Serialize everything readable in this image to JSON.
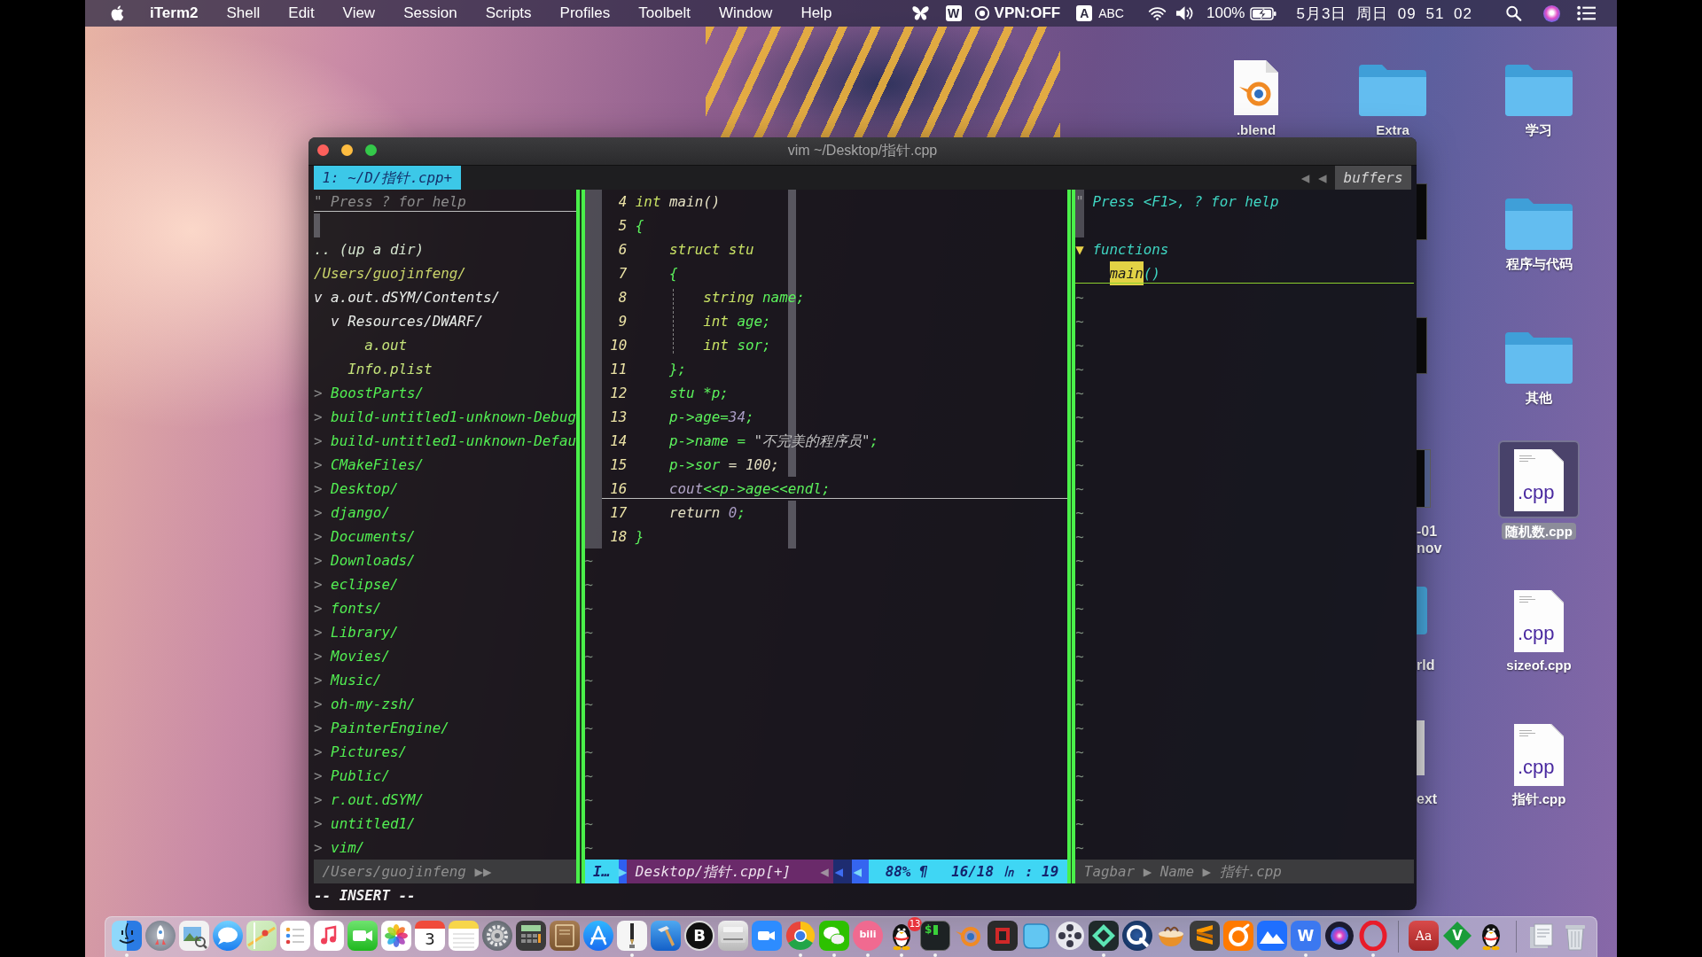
{
  "menu_bar": {
    "app_name": "iTerm2",
    "menus": [
      "Shell",
      "Edit",
      "View",
      "Session",
      "Scripts",
      "Profiles",
      "Toolbelt",
      "Window",
      "Help"
    ],
    "status_items": [
      {
        "kind": "butterfly"
      },
      {
        "kind": "letterbox",
        "text": "W"
      },
      {
        "kind": "vpn",
        "text": "VPN:OFF"
      },
      {
        "kind": "letterbox",
        "text": "A"
      },
      {
        "kind": "input",
        "text": "ABC"
      },
      {
        "kind": "wifi"
      },
      {
        "kind": "volume"
      },
      {
        "kind": "percent",
        "text": "100%"
      },
      {
        "kind": "battery"
      },
      {
        "kind": "clock",
        "text": "5月3日 周日 09 51 02"
      },
      {
        "kind": "search"
      },
      {
        "kind": "orb"
      },
      {
        "kind": "list"
      }
    ]
  },
  "desktop": {
    "icon_columns": [
      {
        "items": [
          {
            "kind": "blend",
            "label": ".blend",
            "selected": false,
            "covered": false
          }
        ]
      },
      {
        "items": [
          {
            "kind": "folder",
            "label": "Extra",
            "selected": false,
            "covered": false
          },
          {
            "kind": "thumbnail",
            "selected": false,
            "covered": true
          },
          {
            "kind": "thumbnail",
            "selected": false,
            "covered": true
          },
          {
            "kind": "screenshot",
            "label_lines": [
              "-01",
              "nov"
            ],
            "selected": false,
            "covered": true
          },
          {
            "kind": "folder",
            "label_lines": [
              "rld"
            ],
            "selected": false,
            "covered": true
          },
          {
            "kind": "document",
            "label_lines": [
              "ext"
            ],
            "selected": false,
            "covered": true
          }
        ]
      },
      {
        "items": [
          {
            "kind": "folder",
            "label": "学习",
            "selected": false,
            "covered": false
          },
          {
            "kind": "folder",
            "label": "程序与代码",
            "selected": false,
            "covered": false
          },
          {
            "kind": "folder",
            "label": "其他",
            "selected": false,
            "covered": false
          },
          {
            "kind": "document",
            "file_type": ".cpp",
            "label": "随机数.cpp",
            "selected": true,
            "covered": false
          },
          {
            "kind": "document",
            "file_type": ".cpp",
            "label": "sizeof.cpp",
            "selected": false,
            "covered": false
          },
          {
            "kind": "document",
            "file_type": ".cpp",
            "label": "指针.cpp",
            "selected": false,
            "covered": false
          }
        ]
      }
    ]
  },
  "terminal": {
    "title": "vim ~/Desktop/指针.cpp",
    "tabline": {
      "tab": "1: ~/D/指针.cpp+",
      "arrows": "◀ ◀",
      "label": "buffers"
    },
    "file_tree": {
      "help": {
        "mark": "\"",
        "text": "Press ? for help",
        "current": true
      },
      "up": ".. (up a dir)",
      "root": "/Users/guojinfeng/",
      "items": [
        {
          "kind": "dir",
          "marker": "v",
          "name": "a.out.dSYM/Contents/",
          "expanded": true,
          "children": [
            {
              "kind": "dir",
              "marker": "v",
              "name": "Resources/DWARF/",
              "expanded": true,
              "children": [
                {
                  "kind": "file",
                  "name": "a.out"
                }
              ]
            },
            {
              "kind": "file",
              "name": "Info.plist"
            }
          ]
        },
        {
          "kind": "dir",
          "marker": ">",
          "name": "BoostParts/",
          "expanded": false
        },
        {
          "kind": "dir",
          "marker": ">",
          "name": "build-untitled1-unknown-Debug",
          "expanded": false
        },
        {
          "kind": "dir",
          "marker": ">",
          "name": "build-untitled1-unknown-Defau",
          "expanded": false
        },
        {
          "kind": "dir",
          "marker": ">",
          "name": "CMakeFiles/",
          "expanded": false
        },
        {
          "kind": "dir",
          "marker": ">",
          "name": "Desktop/",
          "expanded": false
        },
        {
          "kind": "dir",
          "marker": ">",
          "name": "django/",
          "expanded": false
        },
        {
          "kind": "dir",
          "marker": ">",
          "name": "Documents/",
          "expanded": false
        },
        {
          "kind": "dir",
          "marker": ">",
          "name": "Downloads/",
          "expanded": false
        },
        {
          "kind": "dir",
          "marker": ">",
          "name": "eclipse/",
          "expanded": false
        },
        {
          "kind": "dir",
          "marker": ">",
          "name": "fonts/",
          "expanded": false
        },
        {
          "kind": "dir",
          "marker": ">",
          "name": "Library/",
          "expanded": false
        },
        {
          "kind": "dir",
          "marker": ">",
          "name": "Movies/",
          "expanded": false
        },
        {
          "kind": "dir",
          "marker": ">",
          "name": "Music/",
          "expanded": false
        },
        {
          "kind": "dir",
          "marker": ">",
          "name": "oh-my-zsh/",
          "expanded": false
        },
        {
          "kind": "dir",
          "marker": ">",
          "name": "PainterEngine/",
          "expanded": false
        },
        {
          "kind": "dir",
          "marker": ">",
          "name": "Pictures/",
          "expanded": false
        },
        {
          "kind": "dir",
          "marker": ">",
          "name": "Public/",
          "expanded": false
        },
        {
          "kind": "dir",
          "marker": ">",
          "name": "r.out.dSYM/",
          "expanded": false
        },
        {
          "kind": "dir",
          "marker": ">",
          "name": "untitled1/",
          "expanded": false
        },
        {
          "kind": "dir",
          "marker": ">",
          "name": "vim/",
          "expanded": false
        }
      ]
    },
    "editor": {
      "cursor_column": true,
      "lines": [
        {
          "number": "4",
          "current": false,
          "tokens": [
            {
              "kind": "type",
              "text": "int"
            },
            {
              "kind": "plain",
              "text": " main()"
            }
          ]
        },
        {
          "number": "5",
          "current": false,
          "tokens": [
            {
              "kind": "ident",
              "text": "{"
            }
          ],
          "children": [
            {
              "number": "6",
              "current": false,
              "tokens": [
                {
                  "kind": "type",
                  "text": "struct stu"
                }
              ]
            },
            {
              "number": "7",
              "current": false,
              "tokens": [
                {
                  "kind": "ident",
                  "text": "{"
                }
              ],
              "children": [
                {
                  "number": "8",
                  "current": false,
                  "tokens": [
                    {
                      "kind": "type",
                      "text": "string"
                    },
                    {
                      "kind": "ident",
                      "text": " name;"
                    }
                  ]
                },
                {
                  "number": "9",
                  "current": false,
                  "tokens": [
                    {
                      "kind": "type",
                      "text": "int"
                    },
                    {
                      "kind": "ident",
                      "text": " age;"
                    }
                  ]
                },
                {
                  "number": "10",
                  "current": false,
                  "tokens": [
                    {
                      "kind": "type",
                      "text": "int"
                    },
                    {
                      "kind": "ident",
                      "text": " sor;"
                    }
                  ]
                }
              ]
            },
            {
              "number": "11",
              "current": false,
              "tokens": [
                {
                  "kind": "ident",
                  "text": "};"
                }
              ]
            },
            {
              "number": "12",
              "current": false,
              "tokens": [
                {
                  "kind": "ident",
                  "text": "stu *p;"
                }
              ]
            },
            {
              "number": "13",
              "current": false,
              "tokens": [
                {
                  "kind": "ident",
                  "text": "p->age="
                },
                {
                  "kind": "number",
                  "text": "34"
                },
                {
                  "kind": "ident",
                  "text": ";"
                }
              ]
            },
            {
              "number": "14",
              "current": false,
              "tokens": [
                {
                  "kind": "ident",
                  "text": "p->name = "
                },
                {
                  "kind": "string",
                  "text": "\"不完美的程序员\""
                },
                {
                  "kind": "ident",
                  "text": ";"
                }
              ]
            },
            {
              "number": "15",
              "current": false,
              "tokens": [
                {
                  "kind": "ident",
                  "text": "p->sor"
                },
                {
                  "kind": "plain",
                  "text": " = 100;"
                }
              ]
            },
            {
              "number": "16",
              "current": true,
              "tokens": [
                {
                  "kind": "builtin",
                  "text": "cout"
                },
                {
                  "kind": "ident",
                  "text": "<<p->age<<endl;"
                }
              ]
            },
            {
              "number": "17",
              "current": false,
              "tokens": [
                {
                  "kind": "plain",
                  "text": "return "
                },
                {
                  "kind": "number",
                  "text": "0"
                },
                {
                  "kind": "ident",
                  "text": ";"
                }
              ]
            }
          ]
        },
        {
          "number": "18",
          "current": false,
          "tokens": [
            {
              "kind": "ident",
              "text": "}"
            }
          ]
        }
      ],
      "empty_lines": [
        "~",
        "~",
        "~",
        "~",
        "~",
        "~",
        "~",
        "~",
        "~",
        "~",
        "~",
        "~",
        "~"
      ]
    },
    "tagbar": {
      "help": {
        "mark": "\"",
        "text": "Press <F1>, ? for help"
      },
      "groups": [
        {
          "marker": "▼",
          "label": "functions",
          "expanded": true,
          "tags": [
            {
              "name": "main",
              "signature": "()",
              "highlighted": true,
              "current": true
            }
          ]
        }
      ],
      "empty_lines": [
        "~",
        "~",
        "~",
        "~",
        "~",
        "~",
        "~",
        "~",
        "~",
        "~",
        "~",
        "~",
        "~",
        "~",
        "~",
        "~",
        "~",
        "~",
        "~",
        "~",
        "~",
        "~",
        "~",
        "~"
      ]
    },
    "status_line": {
      "tree_path": "/Users/guojinfeng",
      "tree_arrows": "▶▶",
      "segments": [
        {
          "kind": "mode",
          "text": "I…"
        },
        {
          "kind": "arrow-in",
          "text": "▶"
        },
        {
          "kind": "file",
          "text": "Desktop/指针.cpp[+]"
        },
        {
          "kind": "arrow-soft",
          "text": "◀"
        },
        {
          "kind": "arrow-dark",
          "text": "◀"
        },
        {
          "kind": "arrow-light",
          "text": "◀"
        },
        {
          "kind": "info",
          "text": "88% ¶"
        },
        {
          "kind": "info",
          "text": "16/18 ㏑ : 19"
        }
      ],
      "tagbar": "Tagbar ▶ Name ▶ 指针.cpp"
    },
    "command_line": "-- INSERT --"
  },
  "dock": {
    "groups": [
      {
        "apps": [
          {
            "kind": "face",
            "running": true
          },
          {
            "kind": "rocket",
            "running": false
          },
          {
            "kind": "preview",
            "running": false
          },
          {
            "kind": "bubble",
            "running": false
          },
          {
            "kind": "map",
            "running": false
          },
          {
            "kind": "list",
            "running": false
          },
          {
            "kind": "music",
            "running": false
          },
          {
            "kind": "facetime",
            "running": false
          },
          {
            "kind": "photos",
            "running": false
          },
          {
            "kind": "calendar",
            "glyph": "3",
            "running": false
          },
          {
            "kind": "notes",
            "running": false
          },
          {
            "kind": "gear",
            "running": false
          },
          {
            "kind": "calculator",
            "running": false
          },
          {
            "kind": "book",
            "running": false
          },
          {
            "kind": "sticks",
            "running": false
          },
          {
            "kind": "pen",
            "running": true
          },
          {
            "kind": "hammer",
            "running": false
          },
          {
            "kind": "coin",
            "glyph": "B",
            "running": false
          },
          {
            "kind": "scanner",
            "running": false
          },
          {
            "kind": "videocall",
            "running": false
          },
          {
            "kind": "browser",
            "running": true
          },
          {
            "kind": "chats",
            "running": true
          },
          {
            "kind": "bili",
            "glyph": "bili",
            "running": true
          },
          {
            "kind": "penguin",
            "badge": "13",
            "running": true
          },
          {
            "kind": "terminal",
            "glyph": "$",
            "running": true
          },
          {
            "kind": "orbit",
            "running": false
          },
          {
            "kind": "darktile",
            "running": false
          },
          {
            "kind": "blob",
            "running": false
          },
          {
            "kind": "reel",
            "running": false
          },
          {
            "kind": "diamond",
            "running": true
          },
          {
            "kind": "qring",
            "running": false
          },
          {
            "kind": "bowl",
            "running": false
          },
          {
            "kind": "stripes",
            "running": false
          },
          {
            "kind": "swirl",
            "running": false
          },
          {
            "kind": "mountains",
            "running": false
          },
          {
            "kind": "wtile",
            "glyph": "W",
            "running": true
          },
          {
            "kind": "orb",
            "running": false
          },
          {
            "kind": "ring",
            "running": true
          }
        ]
      },
      {
        "apps": [
          {
            "kind": "dictionary",
            "glyph": "Aa",
            "running": false
          },
          {
            "kind": "vim",
            "glyph": "V",
            "running": false
          },
          {
            "kind": "penguin",
            "running": false
          }
        ]
      },
      {
        "apps": [
          {
            "kind": "docstack",
            "running": false
          },
          {
            "kind": "trash",
            "running": false
          }
        ]
      }
    ]
  }
}
